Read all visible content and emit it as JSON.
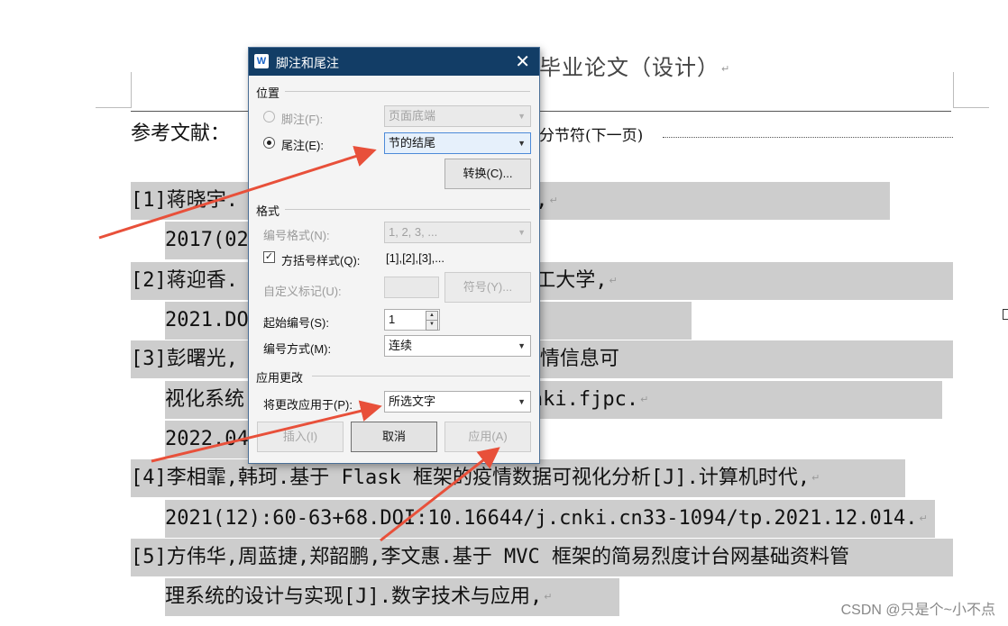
{
  "document": {
    "title_fragment": "毕业论文（设计）",
    "references_heading": "参考文献：",
    "section_break": "分节符(下一页)",
    "references": [
      {
        "id": "ref1-line1",
        "text": "[1]蒋晓宇.                        表设计与实现[J].数字通信世界,"
      },
      {
        "id": "ref1-line2",
        "text": "2017(02"
      },
      {
        "id": "ref2-line1",
        "text": "[2]蒋迎香.                        情防控中的应用研究[D].武汉轻工大学,"
      },
      {
        "id": "ref2-line2",
        "text": "2021.DO                        2021.000158."
      },
      {
        "id": "ref3-line1",
        "text": "[3]彭曙光,                        杰,陆雪艳.面向 ECharts 的疫情信息可"
      },
      {
        "id": "ref3-line2",
        "text": "视化系统                        :80-83.DOI:10.16707/j.cnki.fjpc."
      },
      {
        "id": "ref3-line3",
        "text": "2022.04"
      },
      {
        "id": "ref4-line1",
        "text": "[4]李相霏,韩珂.基于 Flask 框架的疫情数据可视化分析[J].计算机时代,"
      },
      {
        "id": "ref4-line2",
        "text": "2021(12):60-63+68.DOI:10.16644/j.cnki.cn33-1094/tp.2021.12.014."
      },
      {
        "id": "ref5-line1",
        "text": "[5]方伟华,周蓝捷,郑韶鹏,李文惠.基于 MVC 框架的简易烈度计台网基础资料管"
      },
      {
        "id": "ref5-line2",
        "text": "理系统的设计与实现[J].数字技术与应用,"
      }
    ],
    "paragraph_mark": "↵"
  },
  "watermark": "CSDN @只是个~小不点",
  "dialog": {
    "title": "脚注和尾注",
    "close": "✕",
    "app_icon": "W",
    "position_group": "位置",
    "footnote_label": "脚注(F):",
    "footnote_value": "页面底端",
    "endnote_label": "尾注(E):",
    "endnote_value": "节的结尾",
    "convert_button": "转换(C)...",
    "format_group": "格式",
    "number_format_label": "编号格式(N):",
    "number_format_value": "1, 2, 3, ...",
    "bracket_style_label": "方括号样式(Q):",
    "bracket_style_value": "[1],[2],[3],...",
    "custom_mark_label": "自定义标记(U):",
    "symbol_button": "符号(Y)...",
    "start_number_label": "起始编号(S):",
    "start_number_value": "1",
    "numbering_label": "编号方式(M):",
    "numbering_value": "连续",
    "apply_group": "应用更改",
    "apply_to_label": "将更改应用于(P):",
    "apply_to_value": "所选文字",
    "insert_button": "插入(I)",
    "cancel_button": "取消",
    "apply_button": "应用(A)"
  },
  "colors": {
    "title_bar": "#123d66",
    "highlight": "#cdcdcd",
    "arrow": "#e8503a"
  }
}
